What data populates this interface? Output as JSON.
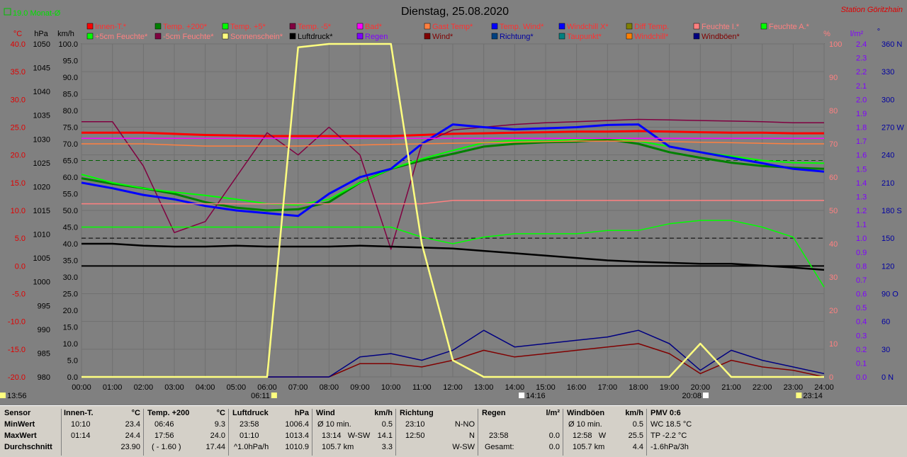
{
  "header": {
    "title": "Dienstag, 25.08.2020",
    "station": "Station Göritzhain",
    "monat": "19.0 Monat-Ø"
  },
  "axes": {
    "temp": {
      "unit": "°C",
      "ticks": [
        "40.0",
        "35.0",
        "30.0",
        "25.0",
        "20.0",
        "15.0",
        "10.0",
        "5.0",
        "0.0",
        "-5.0",
        "-10.0",
        "-15.0",
        "-20.0"
      ],
      "color": "#e00000"
    },
    "press": {
      "unit": "hPa",
      "ticks": [
        "1050",
        "1045",
        "1040",
        "1035",
        "1030",
        "1025",
        "1020",
        "1015",
        "1010",
        "1005",
        "1000",
        "995",
        "990",
        "985",
        "980"
      ]
    },
    "speed": {
      "unit": "km/h",
      "ticks": [
        "100.0",
        "95.0",
        "90.0",
        "85.0",
        "80.0",
        "75.0",
        "70.0",
        "65.0",
        "60.0",
        "55.0",
        "50.0",
        "45.0",
        "40.0",
        "35.0",
        "30.0",
        "25.0",
        "20.0",
        "15.0",
        "10.0",
        "5.0",
        "0.0"
      ]
    },
    "pct": {
      "unit": "%",
      "ticks": [
        "100",
        "90",
        "80",
        "70",
        "60",
        "50",
        "40",
        "30",
        "20",
        "10",
        "0"
      ],
      "color": "#ff8080"
    },
    "rain": {
      "unit": "l/m²",
      "ticks": [
        "2.4",
        "2.3",
        "2.2",
        "2.1",
        "2.0",
        "1.9",
        "1.8",
        "1.7",
        "1.6",
        "1.5",
        "1.4",
        "1.3",
        "1.2",
        "1.1",
        "1.0",
        "0.9",
        "0.8",
        "0.7",
        "0.6",
        "0.5",
        "0.4",
        "0.3",
        "0.2",
        "0.1",
        "0.0"
      ],
      "color": "#8000ff"
    },
    "dir": {
      "unit": "°",
      "ticks": [
        "360 N",
        "330",
        "300",
        "270 W",
        "240",
        "210",
        "180 S",
        "150",
        "120",
        "90 O",
        "60",
        "30",
        "0 N"
      ],
      "color": "#0000a0"
    },
    "time": [
      "00:00",
      "01:00",
      "02:00",
      "03:00",
      "04:00",
      "05:00",
      "06:00",
      "07:00",
      "08:00",
      "09:00",
      "10:00",
      "11:00",
      "12:00",
      "13:00",
      "14:00",
      "15:00",
      "16:00",
      "17:00",
      "18:00",
      "19:00",
      "20:00",
      "21:00",
      "22:00",
      "23:00",
      "24:00"
    ]
  },
  "markers": {
    "now": "13:56",
    "sunrise": "06:11",
    "solarnoon": "14:16",
    "sunset": "20:08",
    "moon": "23:14"
  },
  "legend": [
    {
      "label": "Innen-T.*",
      "color": "#ff0000",
      "text": "#ff3030"
    },
    {
      "label": "Temp. +200*",
      "color": "#008000",
      "text": "#ff3030"
    },
    {
      "label": "Temp. +5*",
      "color": "#00ff00",
      "text": "#ff3030"
    },
    {
      "label": "Temp. -5*",
      "color": "#800040",
      "text": "#ff3030"
    },
    {
      "label": "Bad*",
      "color": "#ff00ff",
      "text": "#ff3030"
    },
    {
      "label": "Gast Temp*",
      "color": "#ff8040",
      "text": "#ff3030"
    },
    {
      "label": "Temp. Wind*",
      "color": "#0000ff",
      "text": "#ff3030"
    },
    {
      "label": "Windchill X*",
      "color": "#0000ff",
      "text": "#ff3030"
    },
    {
      "label": "Diff Temp.",
      "color": "#808000",
      "text": "#ff3030"
    },
    {
      "label": "Feuchte I.*",
      "color": "#ff8080",
      "text": "#ff8080"
    },
    {
      "label": "Feuchte A.*",
      "color": "#00ff00",
      "text": "#ff8080"
    },
    {
      "label": "+5cm Feuchte*",
      "color": "#00ff00",
      "text": "#ff8080"
    },
    {
      "label": "-5cm Feuchte*",
      "color": "#800040",
      "text": "#ff8080"
    },
    {
      "label": "Sonnenschein*",
      "color": "#ffff80",
      "text": "#ff8080"
    },
    {
      "label": "Luftdruck*",
      "color": "#000000",
      "text": "#000000"
    },
    {
      "label": "Regen",
      "color": "#8000ff",
      "text": "#8000ff"
    },
    {
      "label": "Wind*",
      "color": "#800000",
      "text": "#800000"
    },
    {
      "label": "Richtung*",
      "color": "#004080",
      "text": "#0000a0"
    },
    {
      "label": "Taupunkt*",
      "color": "#008080",
      "text": "#ff3030"
    },
    {
      "label": "Windchill*",
      "color": "#ff8000",
      "text": "#ff3030"
    },
    {
      "label": "Windböen*",
      "color": "#000080",
      "text": "#800000"
    }
  ],
  "chart_data": {
    "type": "line",
    "title": "Dienstag, 25.08.2020",
    "x": [
      0,
      1,
      2,
      3,
      4,
      5,
      6,
      7,
      8,
      9,
      10,
      11,
      12,
      13,
      14,
      15,
      16,
      17,
      18,
      19,
      20,
      21,
      22,
      23,
      24
    ],
    "series": [
      {
        "name": "Innen-T.*",
        "axis": "temp",
        "values": [
          24.0,
          24.0,
          24.0,
          23.8,
          23.6,
          23.5,
          23.4,
          23.4,
          23.4,
          23.4,
          23.4,
          23.6,
          23.8,
          23.9,
          24.0,
          24.1,
          24.2,
          24.2,
          24.3,
          24.2,
          24.1,
          24.0,
          24.0,
          23.9,
          23.9
        ]
      },
      {
        "name": "Temp. +200*",
        "axis": "temp",
        "values": [
          15.8,
          14.8,
          14.0,
          13.0,
          11.5,
          10.5,
          10.0,
          10.2,
          11.5,
          15.0,
          17.5,
          19.0,
          20.2,
          21.5,
          22.0,
          22.3,
          22.4,
          22.8,
          22.0,
          20.5,
          19.5,
          18.6,
          18.0,
          17.7,
          17.5
        ]
      },
      {
        "name": "Temp. +5*",
        "axis": "temp",
        "values": [
          16.5,
          15.0,
          14.0,
          13.3,
          12.7,
          12.0,
          11.2,
          11.0,
          12.0,
          15.0,
          17.5,
          19.3,
          20.8,
          22.2,
          22.6,
          22.5,
          22.8,
          23.0,
          22.5,
          21.5,
          20.5,
          19.8,
          19.0,
          18.6,
          18.5
        ]
      },
      {
        "name": "Temp. -5*",
        "axis": "temp",
        "values": [
          26.0,
          26.0,
          18.0,
          6.0,
          8.0,
          16.0,
          24.0,
          20.0,
          25.0,
          20.0,
          3.0,
          22.0,
          24.5,
          25.0,
          25.5,
          25.8,
          26.0,
          26.2,
          26.4,
          26.3,
          26.2,
          26.1,
          26.0,
          25.8,
          25.8
        ]
      },
      {
        "name": "Temp. Wind*",
        "axis": "temp",
        "values": [
          15.0,
          14.0,
          12.8,
          12.0,
          10.8,
          10.0,
          9.5,
          9.0,
          13.0,
          16.0,
          17.5,
          22.0,
          25.5,
          25.0,
          24.6,
          24.8,
          25.0,
          25.4,
          25.5,
          21.5,
          20.5,
          19.5,
          18.5,
          17.5,
          17.0
        ]
      },
      {
        "name": "Gast Temp*",
        "axis": "temp",
        "values": [
          22.0,
          22.0,
          22.0,
          21.8,
          21.6,
          21.6,
          21.6,
          21.6,
          21.7,
          21.8,
          21.9,
          22.0,
          22.1,
          22.2,
          22.3,
          22.4,
          22.5,
          22.5,
          22.5,
          22.4,
          22.3,
          22.2,
          22.1,
          22.0,
          22.0
        ]
      },
      {
        "name": "Bad*",
        "axis": "temp",
        "values": [
          23.0,
          23.0,
          23.0,
          23.0,
          23.0,
          23.0,
          23.0,
          23.0,
          23.0,
          23.0,
          23.0,
          23.0,
          23.0,
          23.0,
          23.0,
          23.0,
          23.0,
          23.0,
          23.0,
          23.0,
          23.0,
          23.0,
          23.0,
          23.0,
          23.0
        ]
      },
      {
        "name": "Feuchte I.*",
        "axis": "pct",
        "values": [
          52,
          52,
          52,
          52,
          52,
          52,
          52,
          52,
          52,
          52,
          52,
          52,
          53,
          53,
          53,
          53,
          53,
          53,
          53,
          53,
          53,
          53,
          53,
          53,
          53
        ]
      },
      {
        "name": "Feuchte A.*",
        "axis": "pct",
        "values": [
          45,
          45,
          45,
          45,
          45,
          45,
          45,
          45,
          45,
          45,
          45,
          42,
          40,
          42,
          43,
          43,
          43,
          44,
          44,
          46,
          47,
          47,
          45,
          42,
          27
        ]
      },
      {
        "name": "Luftdruck*",
        "axis": "press",
        "values": [
          1008.0,
          1008.0,
          1007.6,
          1007.4,
          1007.4,
          1007.6,
          1007.4,
          1007.4,
          1007.4,
          1007.6,
          1007.4,
          1007.2,
          1007.0,
          1006.5,
          1006.0,
          1005.5,
          1005.0,
          1004.5,
          1004.2,
          1004.0,
          1003.8,
          1003.8,
          1003.4,
          1003.0,
          1002.5
        ]
      },
      {
        "name": "Wind*",
        "axis": "speed",
        "values": [
          0,
          0,
          0,
          0,
          0,
          0,
          0,
          0,
          0,
          4,
          4,
          3,
          5,
          8,
          6,
          7,
          8,
          9,
          10,
          7,
          1,
          5,
          3,
          2,
          0
        ]
      },
      {
        "name": "Windböen*",
        "axis": "speed",
        "values": [
          0,
          0,
          0,
          0,
          0,
          0,
          0,
          0,
          0,
          6,
          7,
          5,
          8,
          14,
          9,
          10,
          11,
          12,
          14,
          10,
          2,
          8,
          5,
          3,
          1
        ]
      },
      {
        "name": "Sonnenschein*",
        "axis": "speed",
        "values": [
          0,
          0,
          0,
          0,
          0,
          0,
          0,
          99,
          100,
          100,
          100,
          40,
          5,
          0,
          0,
          0,
          0,
          0,
          0,
          0,
          10,
          0,
          0,
          0,
          0
        ]
      }
    ],
    "ylim_temp": [
      -20,
      40
    ],
    "ylim_press": [
      980,
      1050
    ],
    "ylim_speed": [
      0,
      100
    ],
    "ylim_pct": [
      0,
      100
    ],
    "ylim_rain": [
      0,
      2.4
    ],
    "ylim_dir": [
      0,
      360
    ],
    "grid": true
  },
  "stats": {
    "rows": [
      "Sensor",
      "MinWert",
      "MaxWert",
      "Durchschnitt"
    ],
    "innen": {
      "title": "Innen-T.",
      "unit": "°C",
      "r1": [
        "10:10",
        "23.4"
      ],
      "r2": [
        "01:14",
        "24.4"
      ],
      "r3": [
        "",
        "23.90"
      ]
    },
    "temp": {
      "title": "Temp. +200",
      "unit": "°C",
      "r1": [
        "06:46",
        "9.3"
      ],
      "r2": [
        "17:56",
        "24.0"
      ],
      "r3": [
        "( - 1.60 )",
        "17.44"
      ]
    },
    "luft": {
      "title": "Luftdruck",
      "unit": "hPa",
      "r1": [
        "23:58",
        "1006.4"
      ],
      "r2": [
        "01:10",
        "1013.4"
      ],
      "r3": [
        "^1.0hPa/h",
        "1010.9"
      ]
    },
    "wind": {
      "title": "Wind",
      "unit": "km/h",
      "r1": [
        "Ø 10 min.",
        "0.5"
      ],
      "r2": [
        "13:14   W-SW",
        "14.1"
      ],
      "r3": [
        "105.7 km",
        "3.3"
      ]
    },
    "richt": {
      "title": "Richtung",
      "unit": "",
      "r1": [
        "23:10",
        "N-NO"
      ],
      "r2": [
        "12:50",
        "N"
      ],
      "r3": [
        "",
        "W-SW"
      ]
    },
    "regen": {
      "title": "Regen",
      "unit": "l/m²",
      "r1": [
        "",
        ""
      ],
      "r2": [
        "23:58",
        "0.0"
      ],
      "r3": [
        "Gesamt:",
        "0.0"
      ]
    },
    "boen": {
      "title": "Windböen",
      "unit": "km/h",
      "r1": [
        "Ø 10 min.",
        "0.5"
      ],
      "r2": [
        "12:58   W",
        "25.5"
      ],
      "r3": [
        "105.7 km",
        "4.4"
      ]
    },
    "pmv": {
      "title": "PMV 0:6",
      "r1": "WC 18.5 °C",
      "r2": "TP -2.2 °C",
      "r3": "-1.6hPa/3h"
    }
  }
}
